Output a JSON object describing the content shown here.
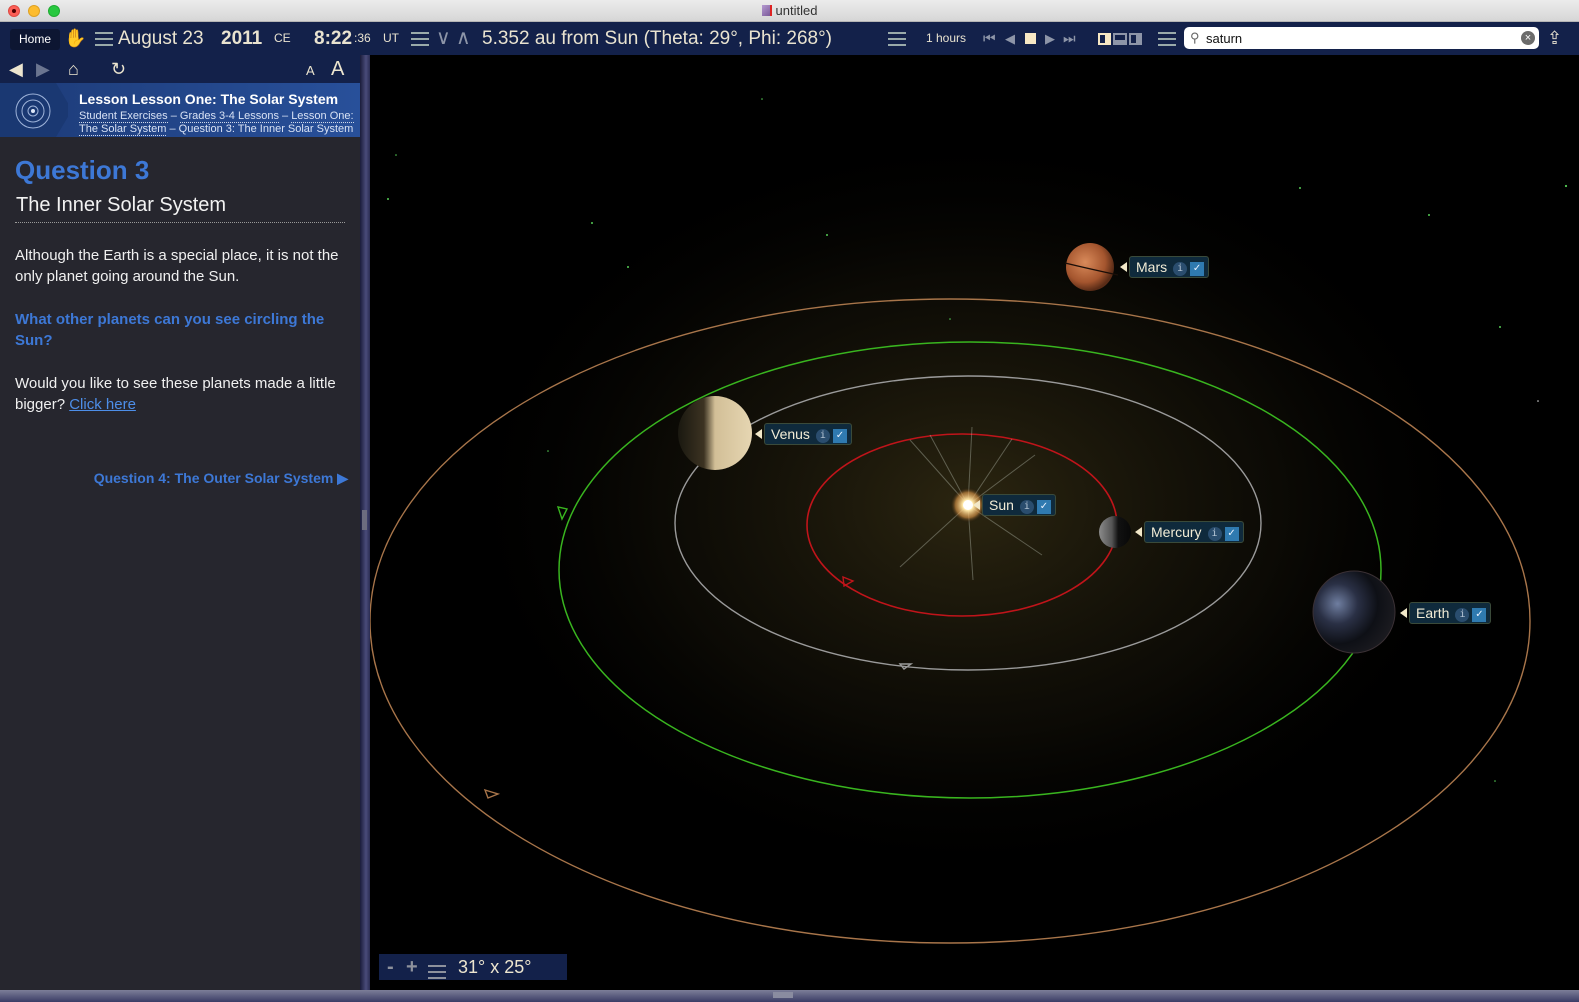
{
  "window": {
    "title": "untitled"
  },
  "toolbar": {
    "home_label": "Home",
    "date": "August 23",
    "year": "2011",
    "era": "CE",
    "time_hm": "8:22",
    "time_sec": ":36",
    "timezone": "UT",
    "position_readout": "5.352 au from Sun (Theta: 29°, Phi: 268°)",
    "time_step": "1 hours",
    "search": {
      "value": "saturn",
      "placeholder": ""
    },
    "icons": [
      "hand-icon",
      "menu-icon",
      "down-icon",
      "up-icon",
      "skip-start-icon",
      "reverse-icon",
      "stop-icon",
      "play-icon",
      "skip-end-icon",
      "layout-icon",
      "share-icon"
    ]
  },
  "sidebar": {
    "nav": {
      "font_small": "A",
      "font_large": "A"
    },
    "lesson_title": "Lesson Lesson One: The Solar System",
    "breadcrumbs": [
      "Student Exercises",
      "Grades 3-4 Lessons",
      "Lesson One: The Solar System",
      "Question 3: The Inner Solar System"
    ],
    "crumb_sep": " – ",
    "question_heading": "Question 3",
    "question_subtitle": "The Inner Solar System",
    "para1": "Although the Earth is a special place, it is not the only planet going around the Sun.",
    "para2": "What other planets can you see circling the Sun?",
    "para3_text": "Would you like to see these planets made a little bigger? ",
    "para3_link": "Click here",
    "next_question": "Question 4: The Outer Solar System",
    "next_arrow": "▶"
  },
  "view": {
    "bodies": [
      {
        "name": "Mars",
        "info": "i",
        "checked": true
      },
      {
        "name": "Venus",
        "info": "i",
        "checked": true
      },
      {
        "name": "Sun",
        "info": "i",
        "checked": true
      },
      {
        "name": "Mercury",
        "info": "i",
        "checked": true
      },
      {
        "name": "Earth",
        "info": "i",
        "checked": true
      }
    ],
    "orbit_colors": {
      "mercury": "#c0141a",
      "venus": "#9a9a9a",
      "earth": "#39b51f",
      "mars": "#a8754a"
    },
    "fov": "31° x 25°",
    "zoom_out": "-",
    "zoom_in": "+"
  }
}
